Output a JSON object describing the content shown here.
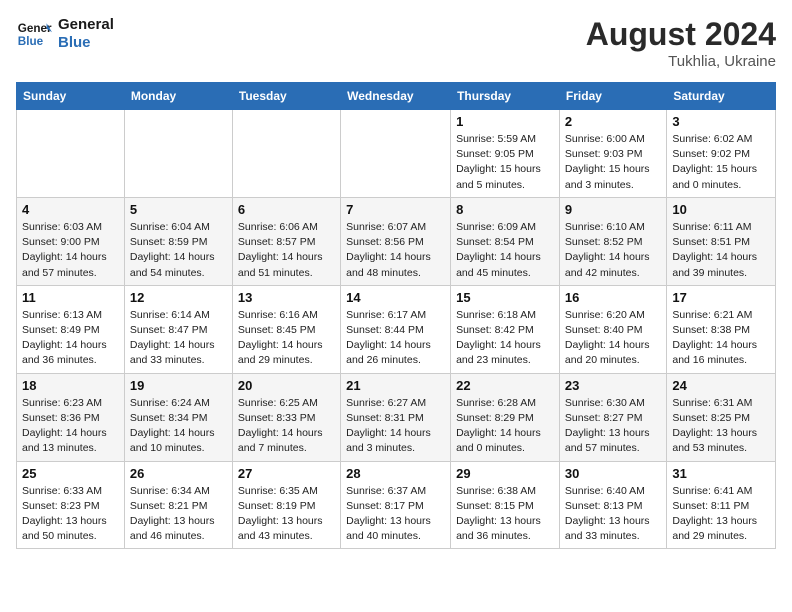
{
  "header": {
    "logo_line1": "General",
    "logo_line2": "Blue",
    "month_year": "August 2024",
    "location": "Tukhlia, Ukraine"
  },
  "weekdays": [
    "Sunday",
    "Monday",
    "Tuesday",
    "Wednesday",
    "Thursday",
    "Friday",
    "Saturday"
  ],
  "weeks": [
    [
      {
        "day": "",
        "info": ""
      },
      {
        "day": "",
        "info": ""
      },
      {
        "day": "",
        "info": ""
      },
      {
        "day": "",
        "info": ""
      },
      {
        "day": "1",
        "info": "Sunrise: 5:59 AM\nSunset: 9:05 PM\nDaylight: 15 hours\nand 5 minutes."
      },
      {
        "day": "2",
        "info": "Sunrise: 6:00 AM\nSunset: 9:03 PM\nDaylight: 15 hours\nand 3 minutes."
      },
      {
        "day": "3",
        "info": "Sunrise: 6:02 AM\nSunset: 9:02 PM\nDaylight: 15 hours\nand 0 minutes."
      }
    ],
    [
      {
        "day": "4",
        "info": "Sunrise: 6:03 AM\nSunset: 9:00 PM\nDaylight: 14 hours\nand 57 minutes."
      },
      {
        "day": "5",
        "info": "Sunrise: 6:04 AM\nSunset: 8:59 PM\nDaylight: 14 hours\nand 54 minutes."
      },
      {
        "day": "6",
        "info": "Sunrise: 6:06 AM\nSunset: 8:57 PM\nDaylight: 14 hours\nand 51 minutes."
      },
      {
        "day": "7",
        "info": "Sunrise: 6:07 AM\nSunset: 8:56 PM\nDaylight: 14 hours\nand 48 minutes."
      },
      {
        "day": "8",
        "info": "Sunrise: 6:09 AM\nSunset: 8:54 PM\nDaylight: 14 hours\nand 45 minutes."
      },
      {
        "day": "9",
        "info": "Sunrise: 6:10 AM\nSunset: 8:52 PM\nDaylight: 14 hours\nand 42 minutes."
      },
      {
        "day": "10",
        "info": "Sunrise: 6:11 AM\nSunset: 8:51 PM\nDaylight: 14 hours\nand 39 minutes."
      }
    ],
    [
      {
        "day": "11",
        "info": "Sunrise: 6:13 AM\nSunset: 8:49 PM\nDaylight: 14 hours\nand 36 minutes."
      },
      {
        "day": "12",
        "info": "Sunrise: 6:14 AM\nSunset: 8:47 PM\nDaylight: 14 hours\nand 33 minutes."
      },
      {
        "day": "13",
        "info": "Sunrise: 6:16 AM\nSunset: 8:45 PM\nDaylight: 14 hours\nand 29 minutes."
      },
      {
        "day": "14",
        "info": "Sunrise: 6:17 AM\nSunset: 8:44 PM\nDaylight: 14 hours\nand 26 minutes."
      },
      {
        "day": "15",
        "info": "Sunrise: 6:18 AM\nSunset: 8:42 PM\nDaylight: 14 hours\nand 23 minutes."
      },
      {
        "day": "16",
        "info": "Sunrise: 6:20 AM\nSunset: 8:40 PM\nDaylight: 14 hours\nand 20 minutes."
      },
      {
        "day": "17",
        "info": "Sunrise: 6:21 AM\nSunset: 8:38 PM\nDaylight: 14 hours\nand 16 minutes."
      }
    ],
    [
      {
        "day": "18",
        "info": "Sunrise: 6:23 AM\nSunset: 8:36 PM\nDaylight: 14 hours\nand 13 minutes."
      },
      {
        "day": "19",
        "info": "Sunrise: 6:24 AM\nSunset: 8:34 PM\nDaylight: 14 hours\nand 10 minutes."
      },
      {
        "day": "20",
        "info": "Sunrise: 6:25 AM\nSunset: 8:33 PM\nDaylight: 14 hours\nand 7 minutes."
      },
      {
        "day": "21",
        "info": "Sunrise: 6:27 AM\nSunset: 8:31 PM\nDaylight: 14 hours\nand 3 minutes."
      },
      {
        "day": "22",
        "info": "Sunrise: 6:28 AM\nSunset: 8:29 PM\nDaylight: 14 hours\nand 0 minutes."
      },
      {
        "day": "23",
        "info": "Sunrise: 6:30 AM\nSunset: 8:27 PM\nDaylight: 13 hours\nand 57 minutes."
      },
      {
        "day": "24",
        "info": "Sunrise: 6:31 AM\nSunset: 8:25 PM\nDaylight: 13 hours\nand 53 minutes."
      }
    ],
    [
      {
        "day": "25",
        "info": "Sunrise: 6:33 AM\nSunset: 8:23 PM\nDaylight: 13 hours\nand 50 minutes."
      },
      {
        "day": "26",
        "info": "Sunrise: 6:34 AM\nSunset: 8:21 PM\nDaylight: 13 hours\nand 46 minutes."
      },
      {
        "day": "27",
        "info": "Sunrise: 6:35 AM\nSunset: 8:19 PM\nDaylight: 13 hours\nand 43 minutes."
      },
      {
        "day": "28",
        "info": "Sunrise: 6:37 AM\nSunset: 8:17 PM\nDaylight: 13 hours\nand 40 minutes."
      },
      {
        "day": "29",
        "info": "Sunrise: 6:38 AM\nSunset: 8:15 PM\nDaylight: 13 hours\nand 36 minutes."
      },
      {
        "day": "30",
        "info": "Sunrise: 6:40 AM\nSunset: 8:13 PM\nDaylight: 13 hours\nand 33 minutes."
      },
      {
        "day": "31",
        "info": "Sunrise: 6:41 AM\nSunset: 8:11 PM\nDaylight: 13 hours\nand 29 minutes."
      }
    ]
  ]
}
